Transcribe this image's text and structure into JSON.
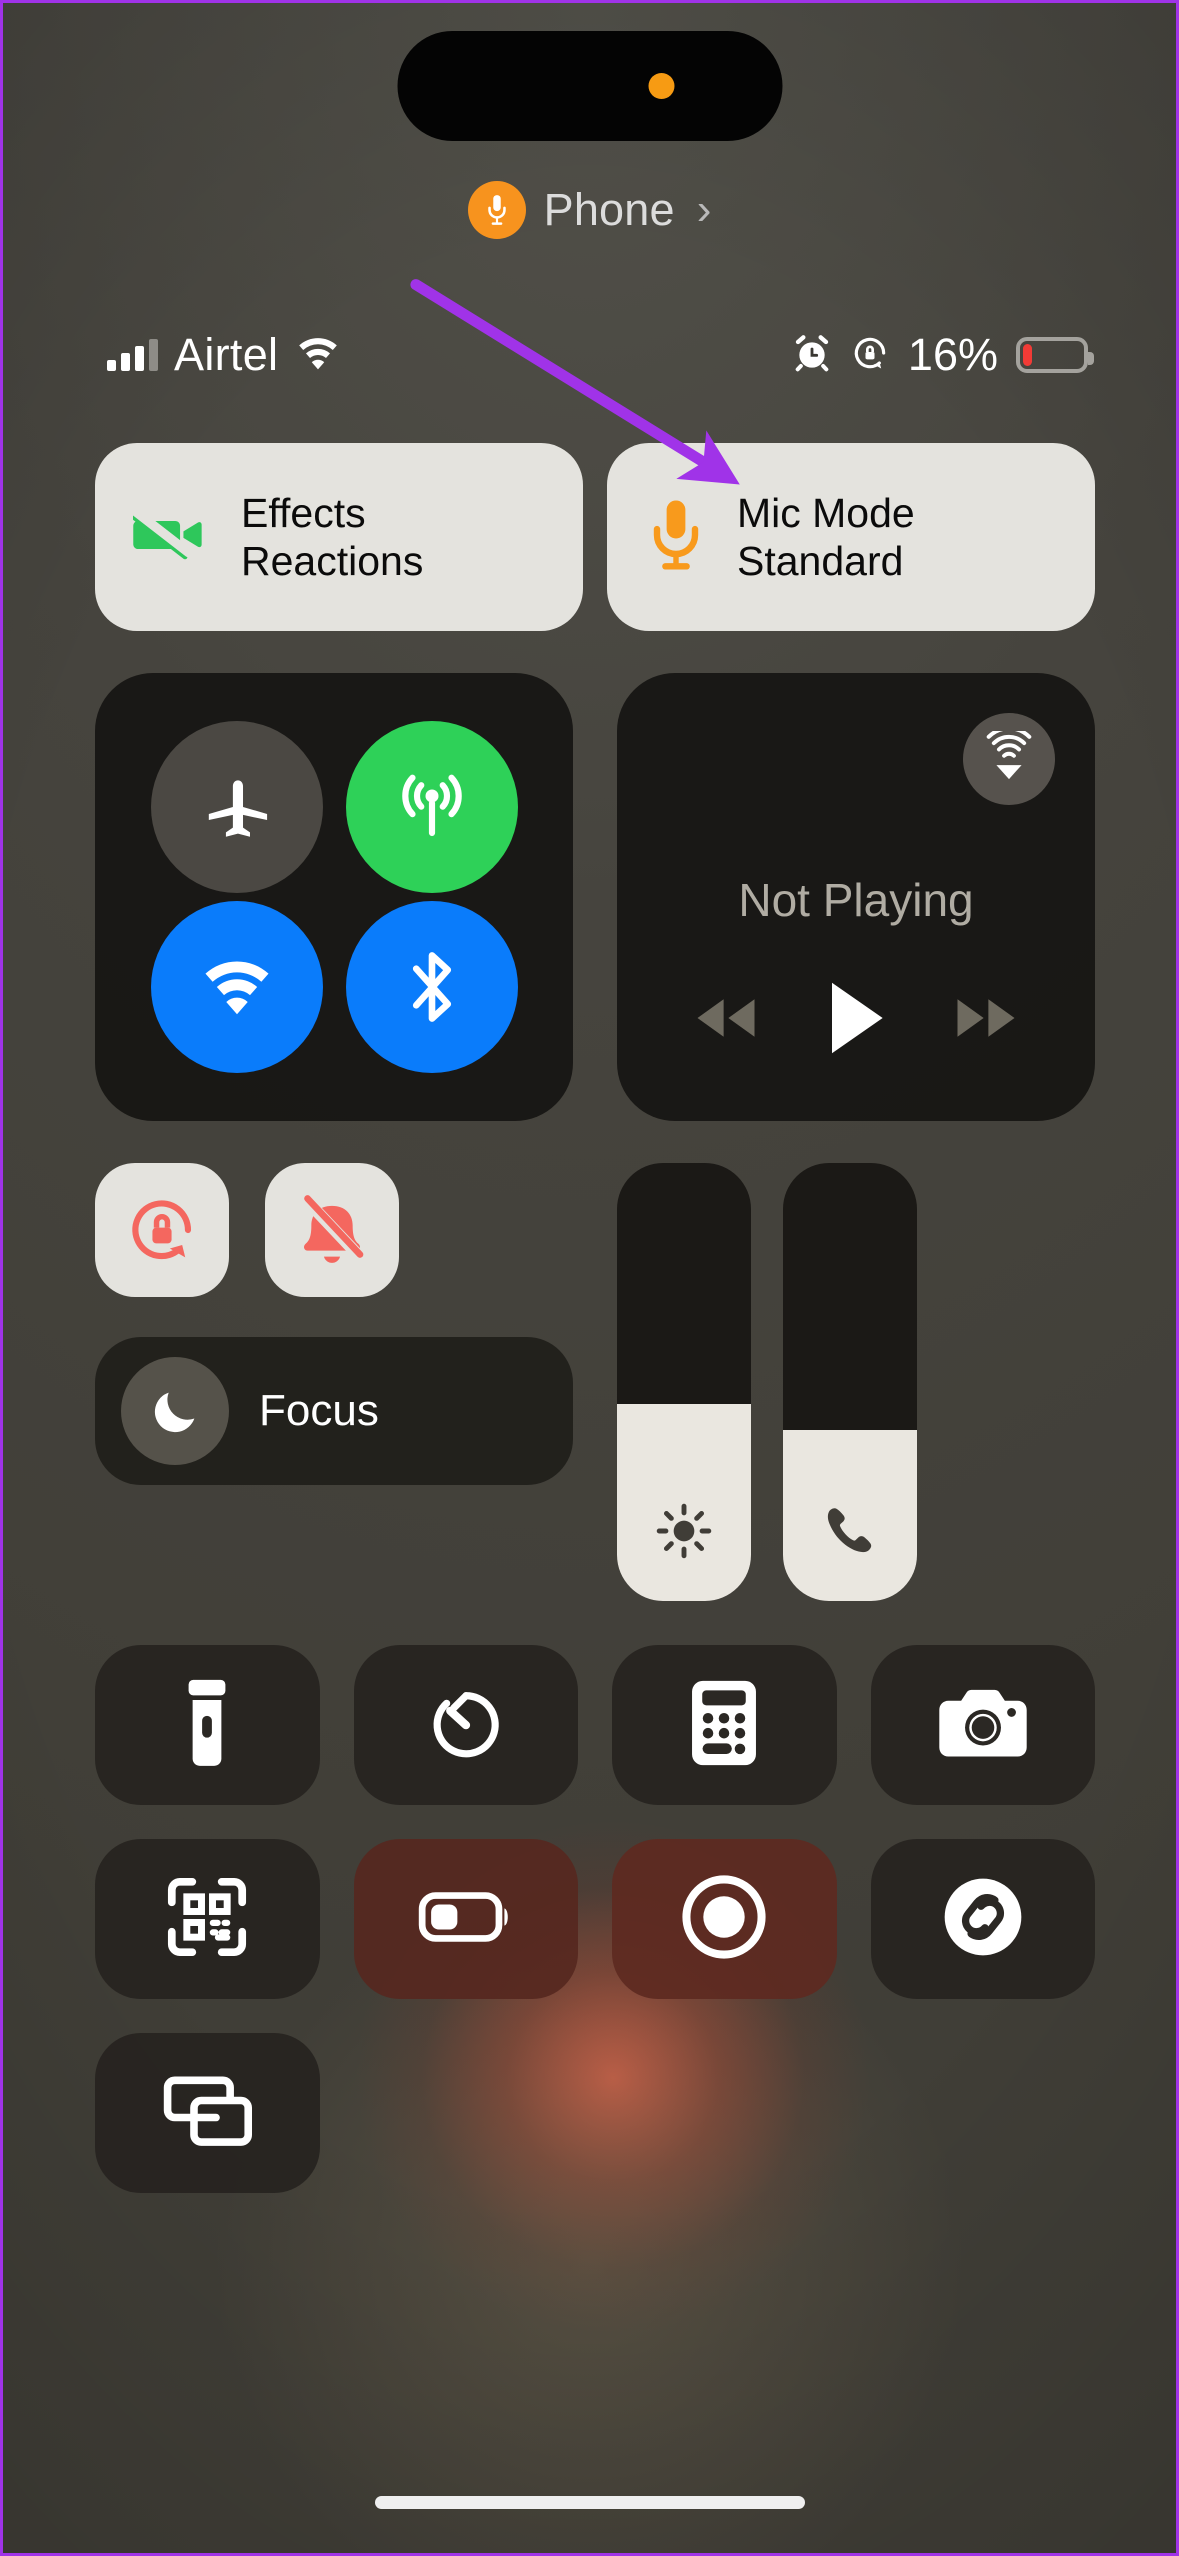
{
  "device": {
    "dynamic_island": {
      "indicator": "mic-in-use-dot",
      "color": "#f7931e"
    },
    "home_indicator": true,
    "annotation_arrow_color": "#a033e8",
    "screen_border_color": "#a033e8"
  },
  "mic_banner": {
    "icon": "microphone-icon",
    "app_label": "Phone",
    "chevron": "›"
  },
  "status_bar": {
    "signal_icon": "cellular-bars-icon",
    "signal_bars_filled": 3,
    "signal_bars_total": 4,
    "carrier": "Airtel",
    "wifi_icon": "wifi-icon",
    "alarm_icon": "alarm-clock-icon",
    "rotation_lock_icon": "rotation-lock-icon",
    "battery_percent": "16%",
    "battery_level": 16,
    "battery_color": "#f23b36"
  },
  "conversation_cards": [
    {
      "id": "effects",
      "icon": "video-camera-slash-icon",
      "icon_color": "#2ec75b",
      "title": "Effects",
      "subtitle": "Reactions"
    },
    {
      "id": "mic-mode",
      "icon": "microphone-icon",
      "icon_color": "#f89a1c",
      "title": "Mic Mode",
      "subtitle": "Standard"
    }
  ],
  "connectivity": {
    "toggles": [
      {
        "id": "airplane-mode",
        "icon": "airplane-icon",
        "state": "off",
        "color": "#4b4843"
      },
      {
        "id": "cellular-data",
        "icon": "cellular-antenna-icon",
        "state": "on",
        "color": "#2ed158"
      },
      {
        "id": "wifi",
        "icon": "wifi-icon",
        "state": "on",
        "color": "#0a7cfb"
      },
      {
        "id": "bluetooth",
        "icon": "bluetooth-icon",
        "state": "on",
        "color": "#0a7cfb"
      }
    ]
  },
  "media_player": {
    "airplay_icon": "airplay-audio-icon",
    "status": "Not Playing",
    "controls": [
      {
        "id": "rewind",
        "icon": "rewind-icon"
      },
      {
        "id": "play",
        "icon": "play-icon"
      },
      {
        "id": "forward",
        "icon": "fast-forward-icon"
      }
    ]
  },
  "quick_toggles": [
    {
      "id": "rotation-lock",
      "icon": "rotation-lock-icon",
      "state": "on",
      "icon_color": "#f4675f"
    },
    {
      "id": "silent-mode",
      "icon": "bell-slash-icon",
      "state": "on",
      "icon_color": "#f4675f"
    }
  ],
  "focus": {
    "icon": "crescent-moon-icon",
    "label": "Focus"
  },
  "sliders": [
    {
      "id": "brightness",
      "icon": "sun-icon",
      "value": 45
    },
    {
      "id": "volume",
      "icon": "phone-handset-icon",
      "value": 39
    }
  ],
  "utility_tiles": [
    {
      "id": "flashlight",
      "icon": "flashlight-icon",
      "tint": "dark"
    },
    {
      "id": "timer",
      "icon": "timer-icon",
      "tint": "dark"
    },
    {
      "id": "calculator",
      "icon": "calculator-icon",
      "tint": "dark"
    },
    {
      "id": "camera",
      "icon": "camera-icon",
      "tint": "dark"
    },
    {
      "id": "qr-code-scanner",
      "icon": "qr-code-icon",
      "tint": "dark"
    },
    {
      "id": "low-power-mode",
      "icon": "low-battery-icon",
      "tint": "warm"
    },
    {
      "id": "screen-recording",
      "icon": "record-circle-icon",
      "tint": "warm2"
    },
    {
      "id": "shazam",
      "icon": "shazam-icon",
      "tint": "dark"
    },
    {
      "id": "screen-mirroring",
      "icon": "screen-mirroring-icon",
      "tint": "dark"
    }
  ]
}
